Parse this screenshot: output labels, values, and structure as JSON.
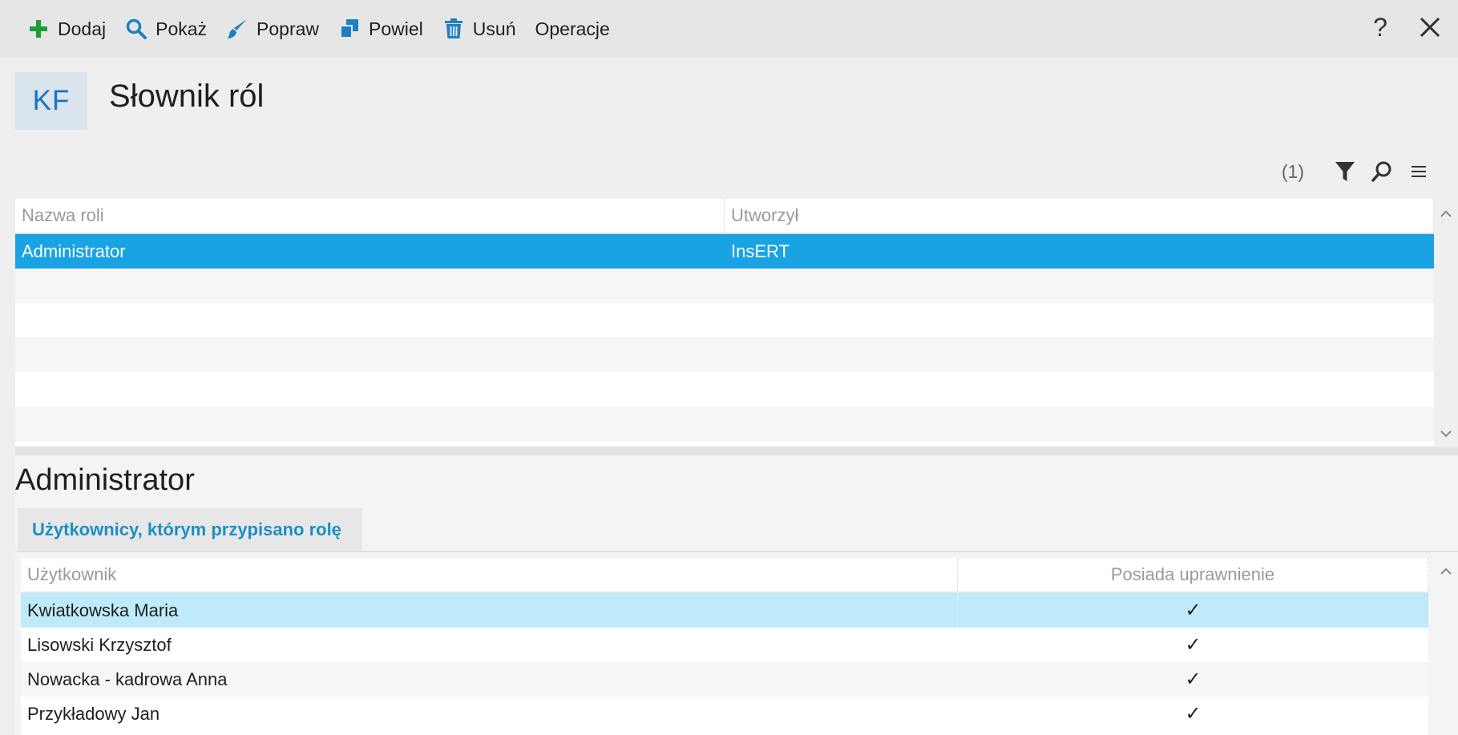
{
  "toolbar": {
    "buttons": [
      {
        "label": "Dodaj",
        "icon": "plus-icon"
      },
      {
        "label": "Pokaż",
        "icon": "search-icon"
      },
      {
        "label": "Popraw",
        "icon": "brush-icon"
      },
      {
        "label": "Powiel",
        "icon": "duplicate-icon"
      },
      {
        "label": "Usuń",
        "icon": "trash-icon"
      },
      {
        "label": "Operacje",
        "icon": ""
      }
    ],
    "help_label": "?"
  },
  "header": {
    "logo": "KF",
    "title": "Słownik ról"
  },
  "grid_tools": {
    "count": "(1)"
  },
  "roles_grid": {
    "columns": [
      "Nazwa roli",
      "Utworzył"
    ],
    "rows": [
      {
        "name": "Administrator",
        "created_by": "InsERT"
      }
    ]
  },
  "details": {
    "title": "Administrator",
    "tab_label": "Użytkownicy, którym przypisano rolę",
    "users_grid": {
      "columns": [
        "Użytkownik",
        "Posiada uprawnienie"
      ],
      "rows": [
        {
          "user": "Kwiatkowska Maria",
          "has_permission": "✓"
        },
        {
          "user": "Lisowski Krzysztof",
          "has_permission": "✓"
        },
        {
          "user": "Nowacka - kadrowa Anna",
          "has_permission": "✓"
        },
        {
          "user": "Przykładowy Jan",
          "has_permission": "✓"
        }
      ]
    }
  },
  "colors": {
    "accent": "#1aa3e3",
    "row_highlight": "#bfeafa",
    "tab_text": "#1c8fc4",
    "plus_icon": "#1f9a3a",
    "tool_icon": "#1f7fc1"
  }
}
